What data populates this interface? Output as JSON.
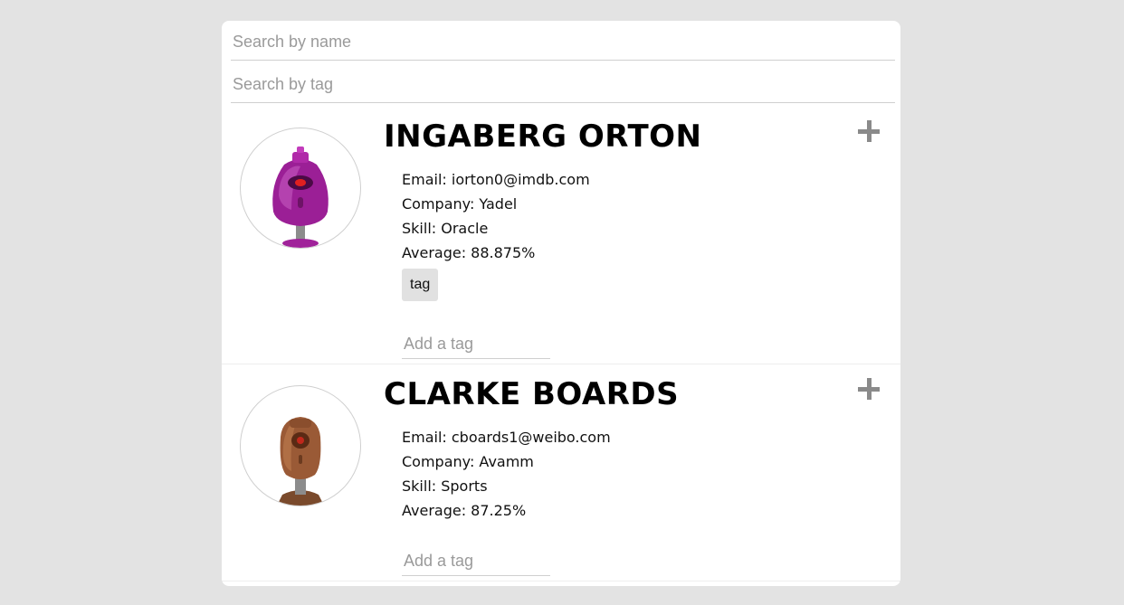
{
  "search": {
    "name_placeholder": "Search by name",
    "tag_placeholder": "Search by tag"
  },
  "students": [
    {
      "name": "INGABERG ORTON",
      "email": "Email: iorton0@imdb.com",
      "company": "Company: Yadel",
      "skill": "Skill: Oracle",
      "average": "Average: 88.875%",
      "tags": [
        "tag"
      ],
      "add_tag_placeholder": "Add a tag",
      "avatar_icon": "purple-robot-avatar",
      "avatar_color": "#9b1f96"
    },
    {
      "name": "CLARKE BOARDS",
      "email": "Email: cboards1@weibo.com",
      "company": "Company: Avamm",
      "skill": "Skill: Sports",
      "average": "Average: 87.25%",
      "tags": [],
      "add_tag_placeholder": "Add a tag",
      "avatar_icon": "brown-robot-avatar",
      "avatar_color": "#9a5a36"
    }
  ],
  "icons": {
    "expand": "plus-icon"
  },
  "colors": {
    "background": "#e3e3e3",
    "card": "#ffffff",
    "tag_chip": "#e1e1e1",
    "plus_icon": "#8a8a8a"
  }
}
